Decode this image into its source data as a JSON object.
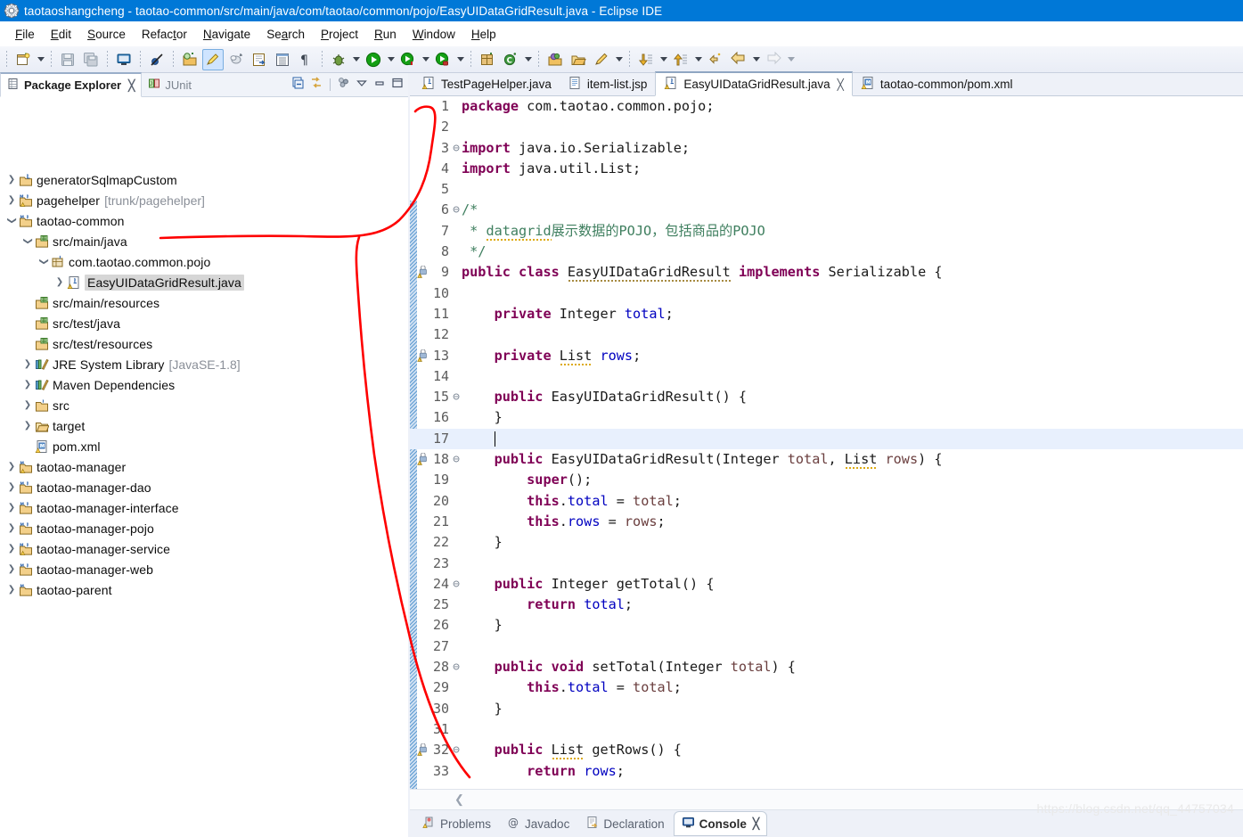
{
  "window": {
    "title": "taotaoshangcheng - taotao-common/src/main/java/com/taotao/common/pojo/EasyUIDataGridResult.java - Eclipse IDE",
    "icon": "eclipse-gear-icon",
    "accent": "#0078d7"
  },
  "menubar": {
    "items": [
      {
        "label": "File",
        "mnemonic": "F"
      },
      {
        "label": "Edit",
        "mnemonic": "E"
      },
      {
        "label": "Source",
        "mnemonic": "S"
      },
      {
        "label": "Refactor",
        "mnemonic": "t"
      },
      {
        "label": "Navigate",
        "mnemonic": "N"
      },
      {
        "label": "Search",
        "mnemonic": "a"
      },
      {
        "label": "Project",
        "mnemonic": "P"
      },
      {
        "label": "Run",
        "mnemonic": "R"
      },
      {
        "label": "Window",
        "mnemonic": "W"
      },
      {
        "label": "Help",
        "mnemonic": "H"
      }
    ]
  },
  "toolbar": {
    "groups": [
      [
        "new-wizard-icon",
        "new-dropdown-arrow"
      ],
      [
        "save-icon",
        "save-all-icon"
      ],
      [
        "print-screen-icon"
      ],
      [
        "skip-breakpoints-icon"
      ],
      [
        "new-java-project-icon",
        "highlight-pen-icon",
        "link-editor-icon",
        "open-task-icon",
        "open-type-icon",
        "show-whitespace-icon"
      ],
      [
        "debug-icon",
        "debug-dropdown-arrow",
        "run-icon",
        "run-dropdown-arrow",
        "coverage-icon",
        "coverage-dropdown-arrow",
        "external-tools-icon",
        "external-dropdown-arrow"
      ],
      [
        "new-package-icon",
        "new-class-icon",
        "new-class-dropdown-arrow"
      ],
      [
        "open-search-icon",
        "open-folder-icon",
        "open-declaration-icon",
        "open-declaration-arrow"
      ],
      [
        "next-annotation-icon",
        "next-annotation-arrow",
        "prev-annotation-icon",
        "prev-annotation-arrow"
      ],
      [
        "back-history-icon",
        "back-arrow-icon",
        "back-dropdown-arrow",
        "forward-arrow-icon",
        "forward-dropdown-arrow"
      ]
    ]
  },
  "explorer": {
    "tabs": [
      {
        "label": "Package Explorer",
        "icon": "package-explorer-icon",
        "active": true,
        "closeable": true
      },
      {
        "label": "JUnit",
        "icon": "junit-icon",
        "active": false,
        "closeable": false
      }
    ],
    "tools": [
      "collapse-all-icon",
      "link-with-editor-icon",
      "view-menu-icon",
      "minimize-icon",
      "maximize-icon"
    ],
    "tree": [
      {
        "label": "generatorSqlmapCustom",
        "indent": 0,
        "twist": "collapsed",
        "icon": "java-project-icon",
        "sub": "",
        "selected": false
      },
      {
        "label": "pagehelper",
        "indent": 0,
        "twist": "collapsed",
        "icon": "maven-java-project-warn-icon",
        "sub": "[trunk/pagehelper]",
        "selected": false
      },
      {
        "label": "taotao-common",
        "indent": 0,
        "twist": "expanded",
        "icon": "maven-java-project-icon",
        "sub": "",
        "selected": false
      },
      {
        "label": "src/main/java",
        "indent": 1,
        "twist": "expanded",
        "icon": "source-folder-icon",
        "sub": "",
        "selected": false
      },
      {
        "label": "com.taotao.common.pojo",
        "indent": 2,
        "twist": "expanded",
        "icon": "package-icon",
        "sub": "",
        "selected": false
      },
      {
        "label": "EasyUIDataGridResult.java",
        "indent": 3,
        "twist": "collapsed",
        "icon": "java-file-warn-icon",
        "sub": "",
        "selected": true
      },
      {
        "label": "src/main/resources",
        "indent": 1,
        "twist": "none",
        "icon": "source-folder-icon",
        "sub": "",
        "selected": false
      },
      {
        "label": "src/test/java",
        "indent": 1,
        "twist": "none",
        "icon": "source-folder-icon",
        "sub": "",
        "selected": false
      },
      {
        "label": "src/test/resources",
        "indent": 1,
        "twist": "none",
        "icon": "source-folder-icon",
        "sub": "",
        "selected": false
      },
      {
        "label": "JRE System Library",
        "indent": 1,
        "twist": "collapsed",
        "icon": "library-icon",
        "sub": "[JavaSE-1.8]",
        "selected": false
      },
      {
        "label": "Maven Dependencies",
        "indent": 1,
        "twist": "collapsed",
        "icon": "library-icon",
        "sub": "",
        "selected": false
      },
      {
        "label": "src",
        "indent": 1,
        "twist": "collapsed",
        "icon": "folder-src-icon",
        "sub": "",
        "selected": false
      },
      {
        "label": "target",
        "indent": 1,
        "twist": "collapsed",
        "icon": "folder-icon",
        "sub": "",
        "selected": false
      },
      {
        "label": "pom.xml",
        "indent": 1,
        "twist": "none",
        "icon": "maven-pom-icon",
        "sub": "",
        "selected": false
      },
      {
        "label": "taotao-manager",
        "indent": 0,
        "twist": "collapsed",
        "icon": "maven-project-warn-icon",
        "sub": "",
        "selected": false
      },
      {
        "label": "taotao-manager-dao",
        "indent": 0,
        "twist": "collapsed",
        "icon": "maven-java-project-icon",
        "sub": "",
        "selected": false
      },
      {
        "label": "taotao-manager-interface",
        "indent": 0,
        "twist": "collapsed",
        "icon": "maven-java-project-icon",
        "sub": "",
        "selected": false
      },
      {
        "label": "taotao-manager-pojo",
        "indent": 0,
        "twist": "collapsed",
        "icon": "maven-java-project-icon",
        "sub": "",
        "selected": false
      },
      {
        "label": "taotao-manager-service",
        "indent": 0,
        "twist": "collapsed",
        "icon": "maven-java-project-warn-icon",
        "sub": "",
        "selected": false
      },
      {
        "label": "taotao-manager-web",
        "indent": 0,
        "twist": "collapsed",
        "icon": "maven-java-project-icon",
        "sub": "",
        "selected": false
      },
      {
        "label": "taotao-parent",
        "indent": 0,
        "twist": "collapsed",
        "icon": "maven-project-icon",
        "sub": "",
        "selected": false
      }
    ]
  },
  "editor": {
    "tabs": [
      {
        "label": "TestPageHelper.java",
        "icon": "java-file-warn-icon",
        "active": false,
        "closeable": false
      },
      {
        "label": "item-list.jsp",
        "icon": "jsp-file-icon",
        "active": false,
        "closeable": false
      },
      {
        "label": "EasyUIDataGridResult.java",
        "icon": "java-file-warn-icon",
        "active": true,
        "closeable": true
      },
      {
        "label": "taotao-common/pom.xml",
        "icon": "maven-pom-icon",
        "active": false,
        "closeable": false
      }
    ],
    "cursor_line": 17,
    "first_line": 1,
    "last_line": 33,
    "fold_lines": [
      3,
      6,
      15,
      18,
      24,
      28,
      32
    ],
    "warning_lines": [
      9,
      13,
      18,
      32
    ],
    "changed_from_line": 6,
    "code": [
      {
        "n": 1,
        "html": "<span class='kw'>package</span> com.taotao.common.pojo;"
      },
      {
        "n": 2,
        "html": ""
      },
      {
        "n": 3,
        "html": "<span class='kw'>import</span> java.io.Serializable;"
      },
      {
        "n": 4,
        "html": "<span class='kw'>import</span> java.util.List;"
      },
      {
        "n": 5,
        "html": ""
      },
      {
        "n": 6,
        "html": "<span class='cmt'>/*</span>"
      },
      {
        "n": 7,
        "html": "<span class='cmt'> * <span class='squig'>datagrid</span>展示数据的POJO，包括商品的POJO</span>"
      },
      {
        "n": 8,
        "html": "<span class='cmt'> */</span>"
      },
      {
        "n": 9,
        "html": "<span class='kw'>public</span> <span class='kw'>class</span> <span class='squig-b'>EasyUIDataGridResult</span> <span class='kw'>implements</span> Serializable {"
      },
      {
        "n": 10,
        "html": ""
      },
      {
        "n": 11,
        "html": "    <span class='kw'>private</span> Integer <span class='fld'>total</span>;"
      },
      {
        "n": 12,
        "html": ""
      },
      {
        "n": 13,
        "html": "    <span class='kw'>private</span> <span class='squig'>List</span> <span class='fld'>rows</span>;"
      },
      {
        "n": 14,
        "html": ""
      },
      {
        "n": 15,
        "html": "    <span class='kw'>public</span> EasyUIDataGridResult() {"
      },
      {
        "n": 16,
        "html": "    }"
      },
      {
        "n": 17,
        "html": "    <span class='caret'></span>"
      },
      {
        "n": 18,
        "html": "    <span class='kw'>public</span> EasyUIDataGridResult(Integer <span class='param'>total</span>, <span class='squig'>List</span> <span class='param'>rows</span>) {"
      },
      {
        "n": 19,
        "html": "        <span class='kw'>super</span>();"
      },
      {
        "n": 20,
        "html": "        <span class='kw'>this</span>.<span class='fld'>total</span> = <span class='param'>total</span>;"
      },
      {
        "n": 21,
        "html": "        <span class='kw'>this</span>.<span class='fld'>rows</span> = <span class='param'>rows</span>;"
      },
      {
        "n": 22,
        "html": "    }"
      },
      {
        "n": 23,
        "html": ""
      },
      {
        "n": 24,
        "html": "    <span class='kw'>public</span> Integer getTotal() {"
      },
      {
        "n": 25,
        "html": "        <span class='kw'>return</span> <span class='fld'>total</span>;"
      },
      {
        "n": 26,
        "html": "    }"
      },
      {
        "n": 27,
        "html": ""
      },
      {
        "n": 28,
        "html": "    <span class='kw'>public</span> <span class='kw'>void</span> setTotal(Integer <span class='param'>total</span>) {"
      },
      {
        "n": 29,
        "html": "        <span class='kw'>this</span>.<span class='fld'>total</span> = <span class='param'>total</span>;"
      },
      {
        "n": 30,
        "html": "    }"
      },
      {
        "n": 31,
        "html": ""
      },
      {
        "n": 32,
        "html": "    <span class='kw'>public</span> <span class='squig'>List</span> getRows() {"
      },
      {
        "n": 33,
        "html": "        <span class='kw'>return</span> <span class='fld'>rows</span>;"
      }
    ]
  },
  "bottom": {
    "tabs": [
      {
        "label": "Problems",
        "icon": "problems-icon",
        "active": false,
        "closeable": false
      },
      {
        "label": "Javadoc",
        "icon": "javadoc-icon",
        "active": false,
        "closeable": false
      },
      {
        "label": "Declaration",
        "icon": "declaration-icon",
        "active": false,
        "closeable": false
      },
      {
        "label": "Console",
        "icon": "console-icon",
        "active": true,
        "closeable": true
      }
    ]
  },
  "watermark": {
    "text": "https://blog.csdn.net/qq_44757034"
  },
  "annotation": {
    "color": "#fe0000",
    "description": "hand-drawn red arrow linking selected file to editor"
  }
}
